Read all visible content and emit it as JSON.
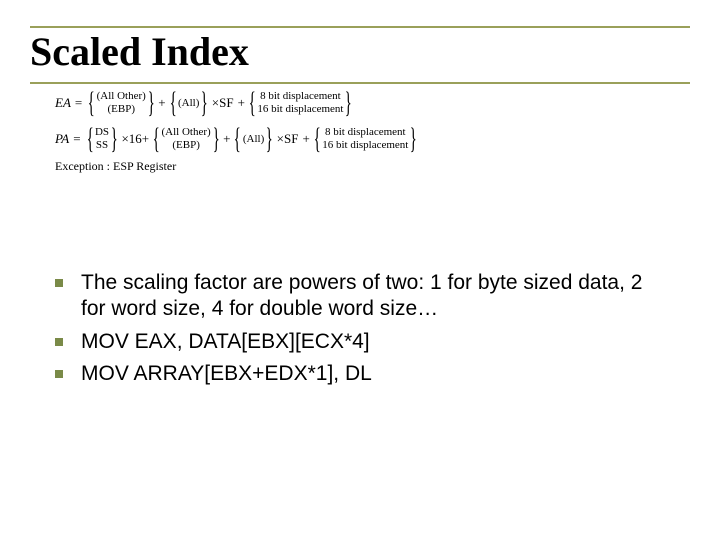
{
  "title": "Scaled Index",
  "formula": {
    "ea_label": "EA",
    "pa_label": "PA",
    "eq": "=",
    "plus": "+",
    "times_sf": "×SF",
    "times_16": "×16+",
    "brace_base_top": "(All Other)",
    "brace_base_bot": "(EBP)",
    "brace_index": "(All)",
    "brace_disp_top": "8 bit displacement",
    "brace_disp_bot": "16 bit displacement",
    "brace_seg_top": "DS",
    "brace_seg_bot": "SS",
    "exception": "Exception : ESP Register"
  },
  "bullets": [
    "The scaling factor are powers of two: 1 for byte sized data, 2 for word size, 4 for double word size…",
    "MOV EAX, DATA[EBX][ECX*4]",
    "MOV ARRAY[EBX+EDX*1], DL"
  ]
}
